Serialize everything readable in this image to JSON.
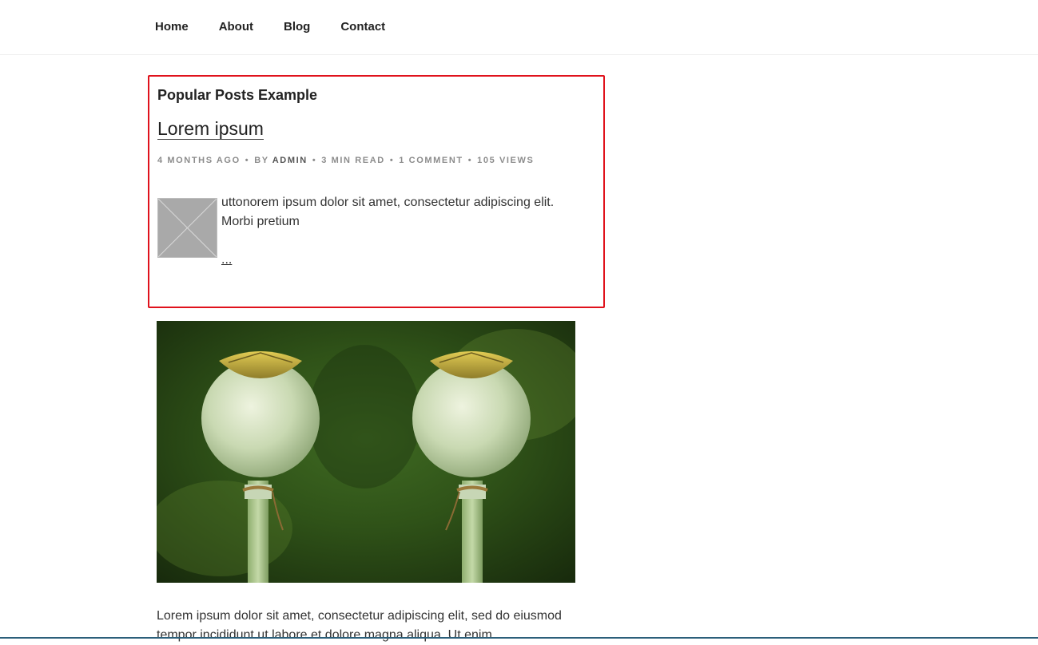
{
  "nav": {
    "items": [
      {
        "label": "Home"
      },
      {
        "label": "About"
      },
      {
        "label": "Blog"
      },
      {
        "label": "Contact"
      }
    ]
  },
  "widget": {
    "title": "Popular Posts Example",
    "post": {
      "title": "Lorem ipsum",
      "meta": {
        "time_ago": "4 months ago",
        "by": "by",
        "author": "admin",
        "read_time": "3 min read",
        "comments": "1 comment",
        "views": "105 views"
      },
      "excerpt": "uttonorem ipsum dolor sit amet, consectetur adipiscing elit. Morbi pretium",
      "more": "..."
    }
  },
  "article": {
    "body": "Lorem ipsum dolor sit amet, consectetur adipiscing elit, sed do eiusmod tempor incididunt ut labore et dolore magna aliqua. Ut enim"
  },
  "colors": {
    "widget_border": "#e0121c",
    "accent_line": "#2b5f7a"
  }
}
